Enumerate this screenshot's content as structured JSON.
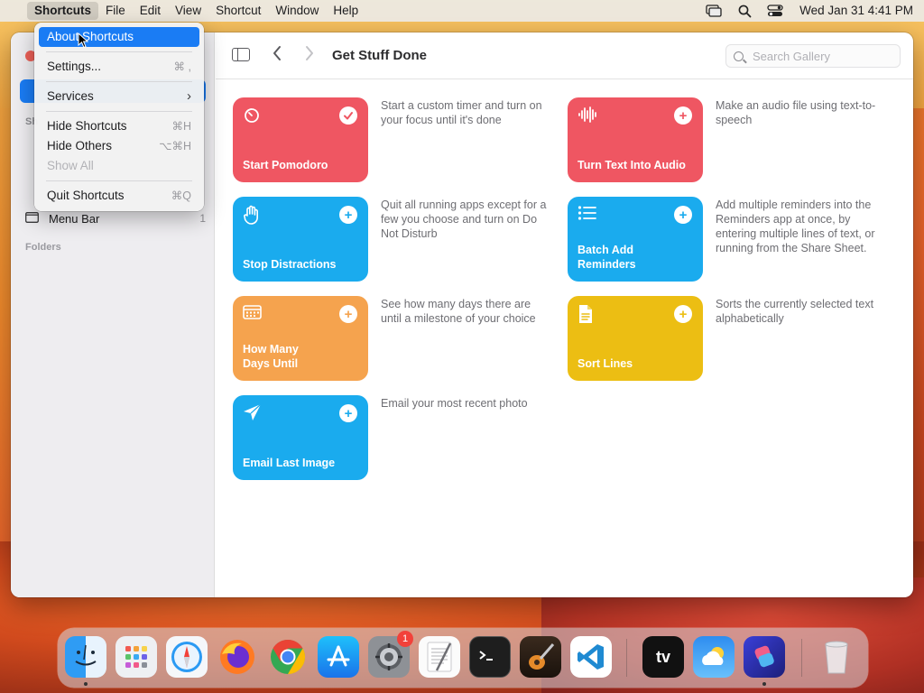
{
  "menubar": {
    "app_name": "Shortcuts",
    "items": [
      "File",
      "Edit",
      "View",
      "Shortcut",
      "Window",
      "Help"
    ],
    "datetime": "Wed Jan 31  4:41 PM"
  },
  "app_menu": {
    "items": [
      {
        "label": "About Shortcuts",
        "shortcut": "",
        "highlighted": true
      },
      {
        "label": "Settings...",
        "shortcut": "⌘ ,"
      },
      {
        "label": "Services",
        "shortcut": "›"
      },
      {
        "label": "Hide Shortcuts",
        "shortcut": "⌘H"
      },
      {
        "label": "Hide Others",
        "shortcut": "⌥⌘H"
      },
      {
        "label": "Show All",
        "shortcut": "",
        "disabled": true
      },
      {
        "label": "Quit Shortcuts",
        "shortcut": "⌘Q"
      }
    ]
  },
  "sidebar": {
    "section_label": "Sh",
    "rows": [
      {
        "label": "Menu Bar",
        "count": "1"
      }
    ],
    "folders_label": "Folders"
  },
  "toolbar": {
    "title": "Get Stuff Done",
    "search_placeholder": "Search Gallery"
  },
  "gallery": {
    "shortcuts": [
      {
        "name": "Start Pomodoro",
        "description": "Start a custom timer and turn on your focus until it's done",
        "color": "#ef5662",
        "icon": "timer-icon",
        "action": "checkmark"
      },
      {
        "name": "Turn Text Into Audio",
        "description": "Make an audio file using text-to-speech",
        "color": "#ef5662",
        "icon": "waveform-icon",
        "action": "plus"
      },
      {
        "name": "Stop Distractions",
        "description": "Quit all running apps except for a few you choose and turn on Do Not Disturb",
        "color": "#1aabee",
        "icon": "hand-icon",
        "action": "plus"
      },
      {
        "name": "Batch Add Reminders",
        "description": "Add multiple reminders into the Reminders app at once, by entering multiple lines of text, or running from the Share Sheet.",
        "color": "#1aabee",
        "icon": "list-icon",
        "action": "plus"
      },
      {
        "name": "How Many Days Until",
        "description": "See how many days there are until a milestone of your choice",
        "color": "#f5a34e",
        "icon": "calendar-icon",
        "action": "plus"
      },
      {
        "name": "Sort Lines",
        "description": "Sorts the currently selected text alphabetically",
        "color": "#ecbe13",
        "icon": "document-icon",
        "action": "plus"
      },
      {
        "name": "Email Last Image",
        "description": "Email your most recent photo",
        "color": "#1aabee",
        "icon": "paper-plane-icon",
        "action": "plus"
      }
    ]
  },
  "dock": {
    "apps": [
      "Finder",
      "Launchpad",
      "Safari",
      "Firefox",
      "Chrome",
      "App Store",
      "System Settings",
      "TextEdit",
      "Terminal",
      "GarageBand",
      "VS Code",
      "Apple TV",
      "Weather",
      "Shortcuts",
      "Trash"
    ],
    "system_settings_badge": "1",
    "tv_label": "tv"
  }
}
